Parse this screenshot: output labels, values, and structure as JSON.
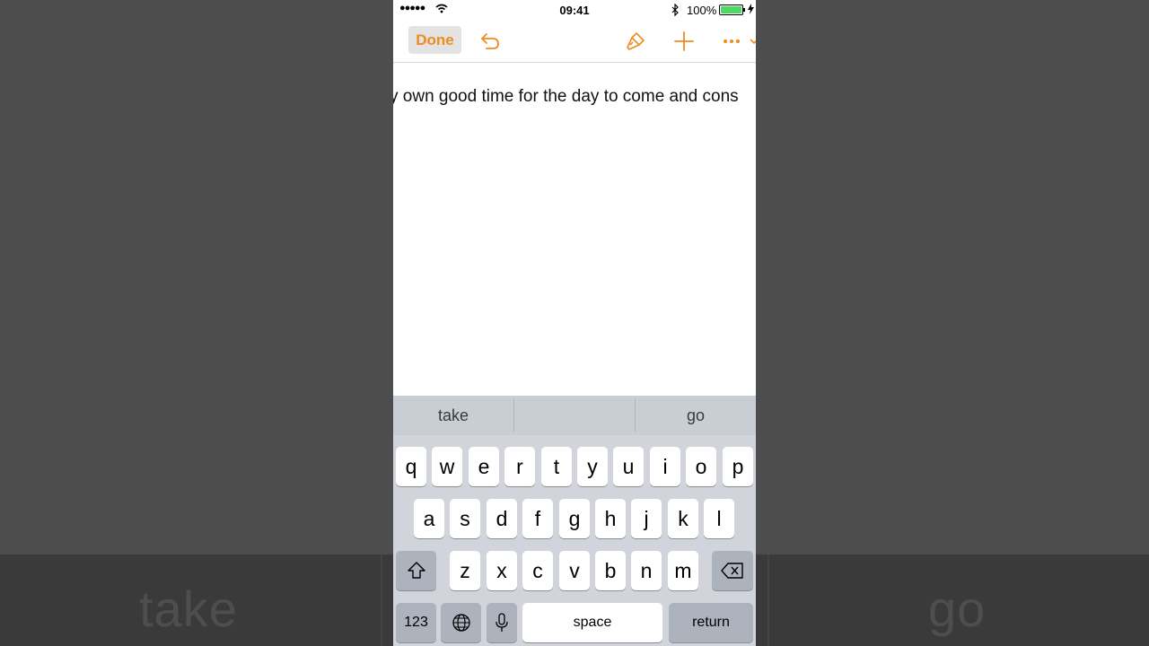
{
  "background": {
    "left_word": "take",
    "right_word": "go"
  },
  "status_bar": {
    "time": "09:41",
    "battery": "100%"
  },
  "toolbar": {
    "done_label": "Done",
    "icons": [
      "undo-icon",
      "format-brush-icon",
      "add-icon",
      "more-icon"
    ],
    "accent_color": "#f08b1d"
  },
  "document": {
    "text": "y own good time for the day to come and cons"
  },
  "keyboard": {
    "suggestions": [
      "take",
      "",
      "go"
    ],
    "row1": [
      "q",
      "w",
      "e",
      "r",
      "t",
      "y",
      "u",
      "i",
      "o",
      "p"
    ],
    "row2": [
      "a",
      "s",
      "d",
      "f",
      "g",
      "h",
      "j",
      "k",
      "l"
    ],
    "row3": [
      "z",
      "x",
      "c",
      "v",
      "b",
      "n",
      "m"
    ],
    "numbers_label": "123",
    "space_label": "space",
    "return_label": "return"
  }
}
